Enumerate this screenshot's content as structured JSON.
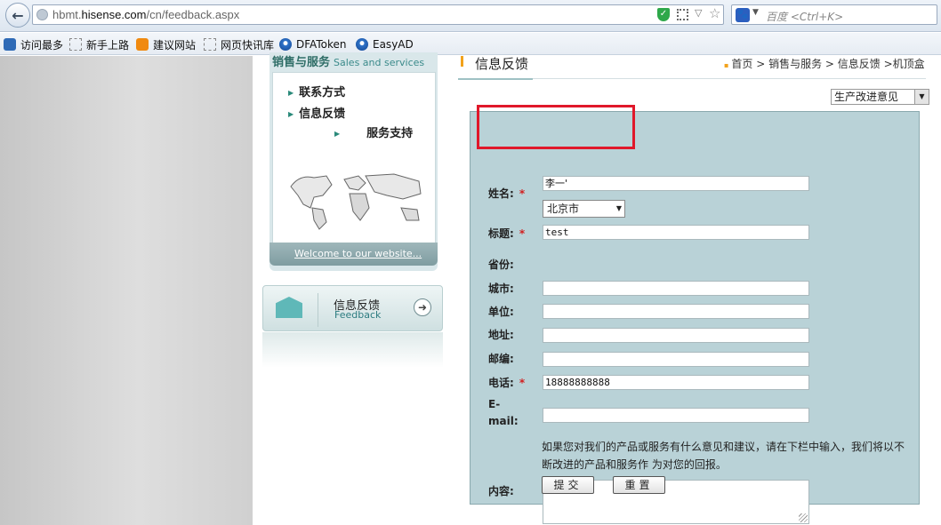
{
  "browser": {
    "url_prefix": "hbmt.",
    "url_domain": "hisense.com",
    "url_path": "/cn/feedback.aspx",
    "search_placeholder": "百度 <Ctrl+K>",
    "bookmarks": [
      {
        "label": "访问最多",
        "icon": "search-doc-icon"
      },
      {
        "label": "新手上路",
        "icon": "page-icon"
      },
      {
        "label": "建议网站",
        "icon": "bulb-icon"
      },
      {
        "label": "网页快讯库",
        "icon": "page-icon"
      },
      {
        "label": "DFAToken",
        "icon": "app-icon"
      },
      {
        "label": "EasyAD",
        "icon": "app-icon"
      }
    ]
  },
  "sidebar": {
    "heading": "销售与服务",
    "heading_en": "Sales and services",
    "links": [
      "联系方式",
      "信息反馈",
      "服务支持"
    ],
    "welcome": "Welcome to our website..."
  },
  "feedback_card": {
    "title": "信息反馈",
    "subtitle": "Feedback"
  },
  "main": {
    "title": "信息反馈",
    "breadcrumb": "首页 > 销售与服务 > 信息反馈 >机顶盒",
    "type_select": "生产改进意见"
  },
  "form": {
    "name_label": "姓名:",
    "name_value": "李一'",
    "title_label": "标题:",
    "title_value": "test",
    "province_label": "省份:",
    "province_value": "北京市",
    "city_label": "城市:",
    "unit_label": "单位:",
    "address_label": "地址:",
    "zip_label": "邮编:",
    "phone_label": "电话:",
    "phone_value": "18888888888",
    "email_label_1": "E-",
    "email_label_2": "mail:",
    "required_mark": "*",
    "hint": "如果您对我们的产品或服务有什么意见和建议，请在下栏中输入，我们将以不断改进的产品和服务作 为对您的回报。",
    "content_label": "内容:",
    "submit_label": "提交",
    "reset_label": "重置"
  }
}
